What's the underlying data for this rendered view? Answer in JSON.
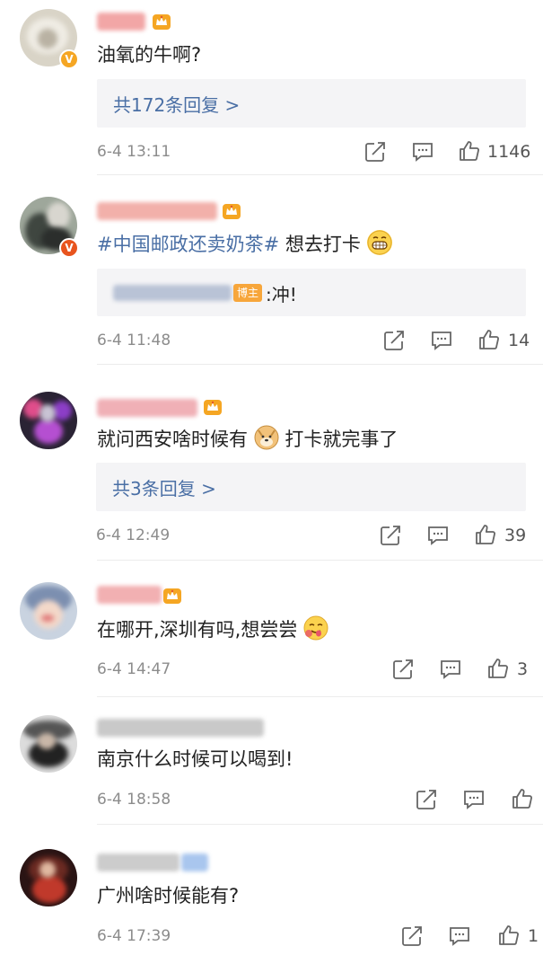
{
  "colors": {
    "link": "#4a6fa5",
    "time": "#8c8c8c",
    "badge_orange": "#f7a63b",
    "vip_gold": "#f5a623"
  },
  "reply_more_arrow": ">",
  "comments": [
    {
      "content": "油氧的牛啊?",
      "replies_label": "共172条回复",
      "time": "6-4 13:11",
      "likes": "1146",
      "verified": "V"
    },
    {
      "tag": "#中国邮政还卖奶茶#",
      "content": "想去打卡",
      "emoji": "grinning-emoji",
      "reply": {
        "badge": "博主",
        "text": ":冲!"
      },
      "time": "6-4 11:48",
      "likes": "14",
      "verified": "V"
    },
    {
      "content_before": "就问西安啥时候有",
      "emoji": "doge-emoji",
      "content_after": "打卡就完事了",
      "replies_label": "共3条回复",
      "time": "6-4 12:49",
      "likes": "39"
    },
    {
      "content": "在哪开,深圳有吗,想尝尝",
      "emoji": "yum-emoji",
      "time": "6-4 14:47",
      "likes": "3"
    },
    {
      "content": "南京什么时候可以喝到!",
      "time": "6-4 18:58",
      "likes": ""
    },
    {
      "content": "广州啥时候能有?",
      "time": "6-4 17:39",
      "likes": "1"
    }
  ]
}
